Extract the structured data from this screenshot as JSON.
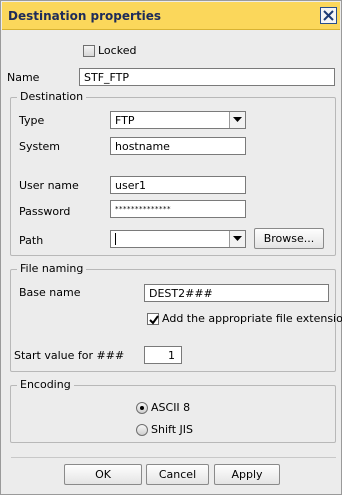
{
  "window": {
    "title": "Destination properties"
  },
  "locked": {
    "label": "Locked",
    "checked": false
  },
  "name": {
    "label": "Name",
    "value": "STF_FTP"
  },
  "destination": {
    "legend": "Destination",
    "type": {
      "label": "Type",
      "value": "FTP"
    },
    "system": {
      "label": "System",
      "value": "hostname"
    },
    "user_name": {
      "label": "User name",
      "value": "user1"
    },
    "password": {
      "label": "Password",
      "value": "**************"
    },
    "path": {
      "label": "Path",
      "value": ""
    },
    "browse_label": "Browse..."
  },
  "file_naming": {
    "legend": "File naming",
    "base_name": {
      "label": "Base name",
      "value": "DEST2###"
    },
    "add_extension": {
      "label": "Add the appropriate file extension",
      "checked": true
    },
    "start_value": {
      "label": "Start value for ###",
      "value": "1"
    }
  },
  "encoding": {
    "legend": "Encoding",
    "options": [
      {
        "label": "ASCII 8",
        "selected": true
      },
      {
        "label": "Shift JIS",
        "selected": false
      }
    ]
  },
  "buttons": {
    "ok": "OK",
    "cancel": "Cancel",
    "apply": "Apply"
  },
  "colors": {
    "titlebar": "#fbd75b",
    "title_text": "#1d2b5a",
    "dialog_bg": "#ececec"
  }
}
